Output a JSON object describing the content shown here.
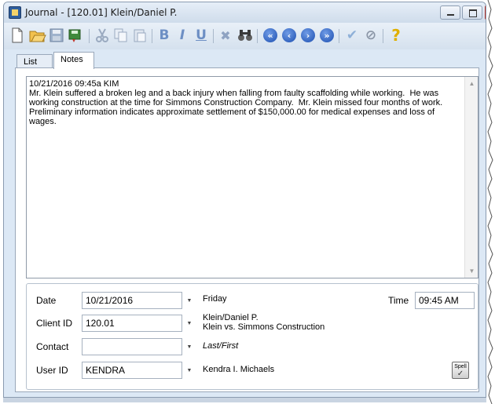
{
  "window": {
    "title": "Journal - [120.01] Klein/Daniel P."
  },
  "toolbar": {
    "buttons": [
      {
        "icon": "new-document-icon",
        "glyph": ""
      },
      {
        "icon": "open-folder-icon",
        "glyph": ""
      },
      {
        "icon": "save-icon",
        "glyph": ""
      },
      {
        "icon": "save-close-icon",
        "glyph": ""
      },
      {
        "icon": "cut-icon",
        "glyph": ""
      },
      {
        "icon": "copy-icon",
        "glyph": ""
      },
      {
        "icon": "paste-icon",
        "glyph": ""
      },
      {
        "icon": "bold-icon",
        "glyph": "B"
      },
      {
        "icon": "italic-icon",
        "glyph": "I"
      },
      {
        "icon": "underline-icon",
        "glyph": "U"
      },
      {
        "icon": "delete-icon",
        "glyph": "✖"
      },
      {
        "icon": "search-icon",
        "glyph": ""
      },
      {
        "icon": "first-record-icon",
        "glyph": "«"
      },
      {
        "icon": "previous-record-icon",
        "glyph": "‹"
      },
      {
        "icon": "next-record-icon",
        "glyph": "›"
      },
      {
        "icon": "last-record-icon",
        "glyph": "»"
      },
      {
        "icon": "checkmark-icon",
        "glyph": "✔"
      },
      {
        "icon": "cancel-icon",
        "glyph": "⊘"
      },
      {
        "icon": "help-icon",
        "glyph": "?"
      }
    ]
  },
  "tabs": [
    {
      "label": "List"
    },
    {
      "label": "Notes"
    }
  ],
  "notes": {
    "text": "10/21/2016 09:45a KIM\nMr. Klein suffered a broken leg and a back injury when falling from faulty scaffolding while working.  He was working construction at the time for Simmons Construction Company.  Mr. Klein missed four months of work.  Preliminary information indicates approximate settlement of $150,000.00 for medical expenses and loss of wages."
  },
  "form": {
    "date": {
      "label": "Date",
      "value": "10/21/2016",
      "info": "Friday"
    },
    "time": {
      "label": "Time",
      "value": "09:45 AM"
    },
    "client": {
      "label": "Client ID",
      "value": "120.01",
      "info_line1": "Klein/Daniel P.",
      "info_line2": "Klein vs. Simmons Construction"
    },
    "contact": {
      "label": "Contact",
      "value": "",
      "info": "Last/First"
    },
    "user": {
      "label": "User ID",
      "value": "KENDRA",
      "info": "Kendra I. Michaels"
    },
    "spell_label": "Spell"
  },
  "colors": {
    "title_bar": "#d6e2f0",
    "toolbar_blue": "#1d4fb0",
    "close_button": "#c0392b"
  }
}
